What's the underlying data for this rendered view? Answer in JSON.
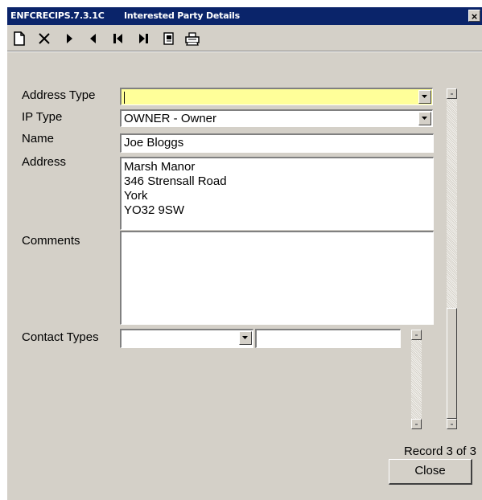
{
  "window": {
    "form_id": "ENFCRECIPS.7.3.1C",
    "title": "Interested Party Details",
    "close_glyph": "×"
  },
  "toolbar": {
    "buttons": [
      {
        "name": "new-record",
        "icon": "new-document-icon"
      },
      {
        "name": "delete-record",
        "icon": "delete-x-icon"
      },
      {
        "name": "next-record",
        "icon": "play-right-icon"
      },
      {
        "name": "previous-record",
        "icon": "play-left-icon"
      },
      {
        "name": "first-record",
        "icon": "first-record-icon"
      },
      {
        "name": "last-record",
        "icon": "last-record-icon"
      },
      {
        "name": "notes",
        "icon": "notepad-icon"
      },
      {
        "name": "print",
        "icon": "printer-icon"
      }
    ]
  },
  "form": {
    "address_type": {
      "label": "Address Type",
      "value": "",
      "highlight": "#ffff99"
    },
    "ip_type": {
      "label": "IP Type",
      "value": "OWNER - Owner"
    },
    "name": {
      "label": "Name",
      "value": "Joe Bloggs"
    },
    "address": {
      "label": "Address",
      "lines": [
        "Marsh Manor",
        "346 Strensall Road",
        "York",
        "YO32 9SW"
      ]
    },
    "comments": {
      "label": "Comments",
      "value": ""
    },
    "contact_types": {
      "label": "Contact Types",
      "select_value": "",
      "text_value": ""
    }
  },
  "footer": {
    "record_status": "Record 3 of 3",
    "close_label": "Close"
  },
  "colors": {
    "titlebar": "#0a246a",
    "dialog": "#d4d0c8",
    "required_field": "#ffff99"
  }
}
